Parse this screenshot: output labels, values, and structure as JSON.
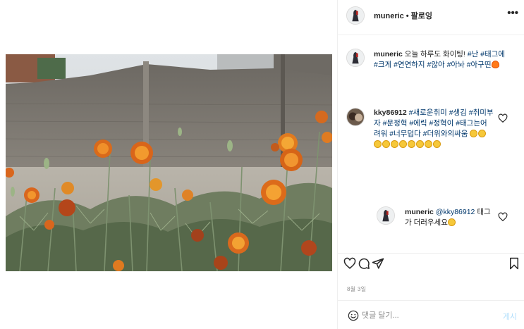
{
  "post": {
    "username": "muneric",
    "separator": "•",
    "follow_label": "팔로잉",
    "more_icon": "more-dots-icon"
  },
  "caption": {
    "username": "muneric",
    "text": "오늘 하루도 화이팅!",
    "tags": [
      "#난",
      "#태그에",
      "#크게",
      "#연연하지",
      "#않아",
      "#아놔",
      "#아구띤"
    ],
    "emoji": "fire"
  },
  "comments": [
    {
      "username": "kky86912",
      "tags": [
        "#새로운취미",
        "#생김",
        "#취미부자",
        "#문정혁",
        "#에릭",
        "#정혁이",
        "#태그는어려워",
        "#너무덥다",
        "#더위와의싸움"
      ],
      "emoji_count": 10,
      "emoji": "weary-face"
    },
    {
      "username": "muneric",
      "mention": "@kky86912",
      "text": "태그가 더러우세요",
      "emoji": "astonished-face"
    }
  ],
  "actions": {
    "like": "heart-icon",
    "comment": "comment-bubble-icon",
    "share": "paper-plane-icon",
    "save": "bookmark-icon"
  },
  "date": "8월 3일",
  "add_comment": {
    "placeholder": "댓글 달기...",
    "post_label": "게시",
    "emoji_icon": "smiley-icon"
  },
  "colors": {
    "text": "#262626",
    "hashtag": "#00376b",
    "muted": "#8e8e8e",
    "post_disabled": "#b2dffc",
    "divider": "#efefef"
  }
}
